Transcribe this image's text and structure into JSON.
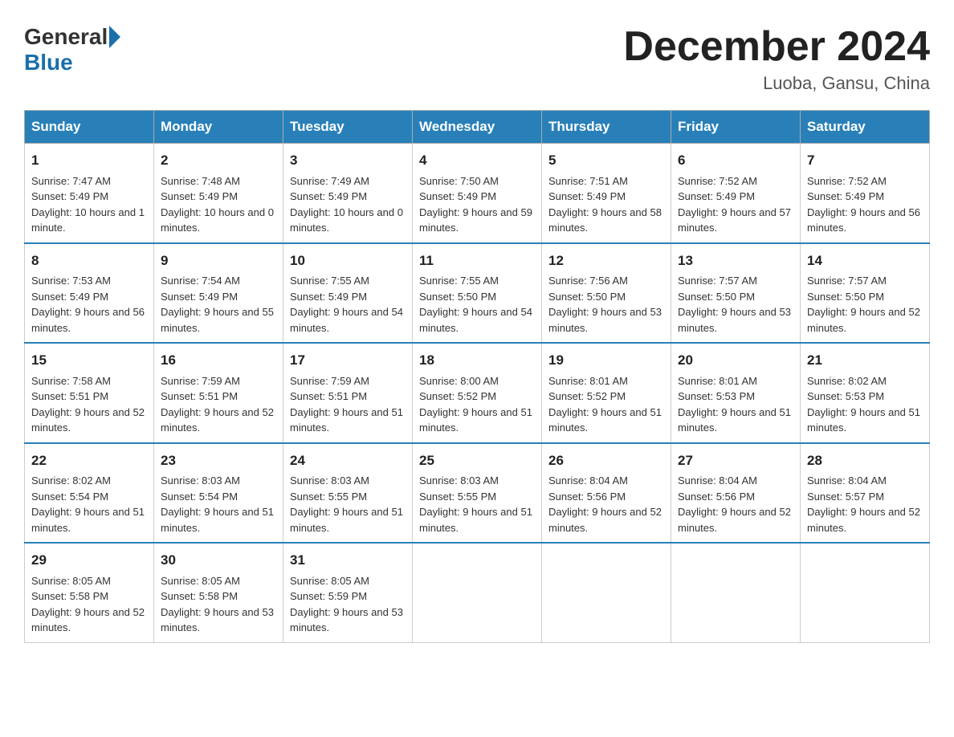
{
  "header": {
    "logo_general": "General",
    "logo_blue": "Blue",
    "month_title": "December 2024",
    "location": "Luoba, Gansu, China"
  },
  "days_of_week": [
    "Sunday",
    "Monday",
    "Tuesday",
    "Wednesday",
    "Thursday",
    "Friday",
    "Saturday"
  ],
  "weeks": [
    [
      {
        "day": "1",
        "sunrise": "7:47 AM",
        "sunset": "5:49 PM",
        "daylight": "10 hours and 1 minute."
      },
      {
        "day": "2",
        "sunrise": "7:48 AM",
        "sunset": "5:49 PM",
        "daylight": "10 hours and 0 minutes."
      },
      {
        "day": "3",
        "sunrise": "7:49 AM",
        "sunset": "5:49 PM",
        "daylight": "10 hours and 0 minutes."
      },
      {
        "day": "4",
        "sunrise": "7:50 AM",
        "sunset": "5:49 PM",
        "daylight": "9 hours and 59 minutes."
      },
      {
        "day": "5",
        "sunrise": "7:51 AM",
        "sunset": "5:49 PM",
        "daylight": "9 hours and 58 minutes."
      },
      {
        "day": "6",
        "sunrise": "7:52 AM",
        "sunset": "5:49 PM",
        "daylight": "9 hours and 57 minutes."
      },
      {
        "day": "7",
        "sunrise": "7:52 AM",
        "sunset": "5:49 PM",
        "daylight": "9 hours and 56 minutes."
      }
    ],
    [
      {
        "day": "8",
        "sunrise": "7:53 AM",
        "sunset": "5:49 PM",
        "daylight": "9 hours and 56 minutes."
      },
      {
        "day": "9",
        "sunrise": "7:54 AM",
        "sunset": "5:49 PM",
        "daylight": "9 hours and 55 minutes."
      },
      {
        "day": "10",
        "sunrise": "7:55 AM",
        "sunset": "5:49 PM",
        "daylight": "9 hours and 54 minutes."
      },
      {
        "day": "11",
        "sunrise": "7:55 AM",
        "sunset": "5:50 PM",
        "daylight": "9 hours and 54 minutes."
      },
      {
        "day": "12",
        "sunrise": "7:56 AM",
        "sunset": "5:50 PM",
        "daylight": "9 hours and 53 minutes."
      },
      {
        "day": "13",
        "sunrise": "7:57 AM",
        "sunset": "5:50 PM",
        "daylight": "9 hours and 53 minutes."
      },
      {
        "day": "14",
        "sunrise": "7:57 AM",
        "sunset": "5:50 PM",
        "daylight": "9 hours and 52 minutes."
      }
    ],
    [
      {
        "day": "15",
        "sunrise": "7:58 AM",
        "sunset": "5:51 PM",
        "daylight": "9 hours and 52 minutes."
      },
      {
        "day": "16",
        "sunrise": "7:59 AM",
        "sunset": "5:51 PM",
        "daylight": "9 hours and 52 minutes."
      },
      {
        "day": "17",
        "sunrise": "7:59 AM",
        "sunset": "5:51 PM",
        "daylight": "9 hours and 51 minutes."
      },
      {
        "day": "18",
        "sunrise": "8:00 AM",
        "sunset": "5:52 PM",
        "daylight": "9 hours and 51 minutes."
      },
      {
        "day": "19",
        "sunrise": "8:01 AM",
        "sunset": "5:52 PM",
        "daylight": "9 hours and 51 minutes."
      },
      {
        "day": "20",
        "sunrise": "8:01 AM",
        "sunset": "5:53 PM",
        "daylight": "9 hours and 51 minutes."
      },
      {
        "day": "21",
        "sunrise": "8:02 AM",
        "sunset": "5:53 PM",
        "daylight": "9 hours and 51 minutes."
      }
    ],
    [
      {
        "day": "22",
        "sunrise": "8:02 AM",
        "sunset": "5:54 PM",
        "daylight": "9 hours and 51 minutes."
      },
      {
        "day": "23",
        "sunrise": "8:03 AM",
        "sunset": "5:54 PM",
        "daylight": "9 hours and 51 minutes."
      },
      {
        "day": "24",
        "sunrise": "8:03 AM",
        "sunset": "5:55 PM",
        "daylight": "9 hours and 51 minutes."
      },
      {
        "day": "25",
        "sunrise": "8:03 AM",
        "sunset": "5:55 PM",
        "daylight": "9 hours and 51 minutes."
      },
      {
        "day": "26",
        "sunrise": "8:04 AM",
        "sunset": "5:56 PM",
        "daylight": "9 hours and 52 minutes."
      },
      {
        "day": "27",
        "sunrise": "8:04 AM",
        "sunset": "5:56 PM",
        "daylight": "9 hours and 52 minutes."
      },
      {
        "day": "28",
        "sunrise": "8:04 AM",
        "sunset": "5:57 PM",
        "daylight": "9 hours and 52 minutes."
      }
    ],
    [
      {
        "day": "29",
        "sunrise": "8:05 AM",
        "sunset": "5:58 PM",
        "daylight": "9 hours and 52 minutes."
      },
      {
        "day": "30",
        "sunrise": "8:05 AM",
        "sunset": "5:58 PM",
        "daylight": "9 hours and 53 minutes."
      },
      {
        "day": "31",
        "sunrise": "8:05 AM",
        "sunset": "5:59 PM",
        "daylight": "9 hours and 53 minutes."
      },
      null,
      null,
      null,
      null
    ]
  ]
}
